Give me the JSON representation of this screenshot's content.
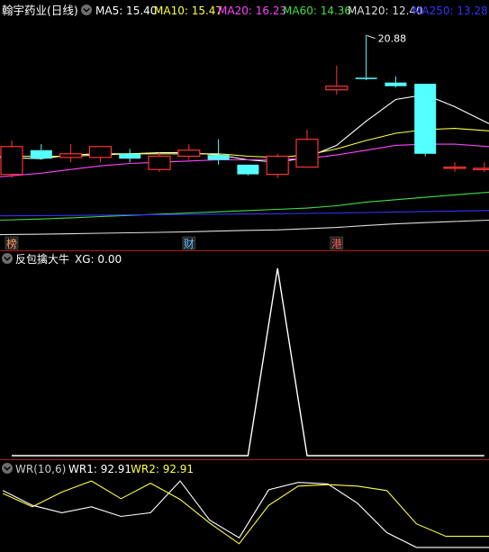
{
  "header": {
    "title": "翰宇药业(日线)",
    "ma_labels": [
      {
        "text": "MA5: 15.40",
        "color": "#ffffff"
      },
      {
        "text": "MA10: 15.47",
        "color": "#ffff44"
      },
      {
        "text": "MA20: 16.23",
        "color": "#ff44ff"
      },
      {
        "text": "MA60: 14.36",
        "color": "#44dd44"
      },
      {
        "text": "MA120: 12.40",
        "color": "#dddddd"
      },
      {
        "text": "MA250: 13.28",
        "color": "#3333ff"
      }
    ]
  },
  "colors": {
    "up": "#ff3333",
    "down": "#54ffff",
    "separator": "#b01818",
    "ma5": "#ffffff",
    "ma10": "#ffff44",
    "ma20": "#ff44ff",
    "ma60": "#44dd44",
    "ma120": "#dddddd",
    "ma250": "#3333ff",
    "xg": "#ffffff",
    "wr1": "#ffffff",
    "wr2": "#ffff44"
  },
  "markers": [
    {
      "text": "榜",
      "bar": 0,
      "color": "#ff9966"
    },
    {
      "text": "财",
      "bar": 6,
      "color": "#66bbff"
    },
    {
      "text": "港",
      "bar": 11,
      "color": "#ff5555"
    }
  ],
  "indicator": {
    "name": "反包擒大牛",
    "value_label": "XG: 0.00"
  },
  "wr_panel": {
    "name": "WR(10,6)",
    "wr1_label": "WR1: 92.91",
    "wr2_label": "WR2: 92.91"
  },
  "chart_data": [
    {
      "type": "candlestick",
      "title": "翰宇药业(日线)",
      "price_range": [
        12.4,
        21.2
      ],
      "candles": [
        {
          "open": 15.1,
          "high": 16.5,
          "low": 14.95,
          "close": 16.25
        },
        {
          "open": 16.1,
          "high": 16.35,
          "low": 15.7,
          "close": 15.75
        },
        {
          "open": 15.8,
          "high": 16.35,
          "low": 15.6,
          "close": 15.95
        },
        {
          "open": 15.8,
          "high": 16.25,
          "low": 15.6,
          "close": 16.25
        },
        {
          "open": 15.95,
          "high": 16.15,
          "low": 15.6,
          "close": 15.75
        },
        {
          "open": 15.3,
          "high": 16.0,
          "low": 15.2,
          "close": 15.85
        },
        {
          "open": 15.85,
          "high": 16.35,
          "low": 15.7,
          "close": 16.1
        },
        {
          "open": 15.9,
          "high": 16.55,
          "low": 15.5,
          "close": 15.7
        },
        {
          "open": 15.5,
          "high": 15.5,
          "low": 15.05,
          "close": 15.1
        },
        {
          "open": 15.1,
          "high": 15.95,
          "low": 14.95,
          "close": 15.85
        },
        {
          "open": 15.4,
          "high": 16.95,
          "low": 15.4,
          "close": 16.55
        },
        {
          "open": 18.6,
          "high": 19.6,
          "low": 18.4,
          "close": 18.75
        },
        {
          "open": 19.1,
          "high": 20.88,
          "low": 19.0,
          "close": 19.05
        },
        {
          "open": 18.9,
          "high": 19.15,
          "low": 18.7,
          "close": 18.75
        },
        {
          "open": 18.85,
          "high": 18.85,
          "low": 15.85,
          "close": 15.95
        },
        {
          "open": 15.4,
          "high": 15.6,
          "low": 15.2,
          "close": 15.4
        },
        {
          "open": 15.3,
          "high": 15.6,
          "low": 15.2,
          "close": 15.35
        }
      ],
      "annotations": [
        {
          "text": "20.88",
          "bar": 12,
          "price": 20.88
        }
      ],
      "series": [
        {
          "name": "MA5",
          "values": [
            15.8,
            15.75,
            15.9,
            15.95,
            15.95,
            16.0,
            16.0,
            15.9,
            15.7,
            15.6,
            15.8,
            16.3,
            17.3,
            18.2,
            18.4,
            17.9,
            17.2
          ]
        },
        {
          "name": "MA10",
          "values": [
            15.85,
            15.85,
            15.85,
            15.9,
            15.95,
            15.95,
            15.95,
            15.95,
            15.85,
            15.8,
            15.9,
            16.15,
            16.5,
            16.8,
            16.95,
            17.0,
            16.9
          ]
        },
        {
          "name": "MA20",
          "values": [
            15.0,
            15.15,
            15.3,
            15.45,
            15.55,
            15.6,
            15.65,
            15.7,
            15.7,
            15.72,
            15.75,
            15.9,
            16.1,
            16.3,
            16.35,
            16.35,
            16.25
          ]
        },
        {
          "name": "MA60",
          "values": [
            13.2,
            13.25,
            13.3,
            13.35,
            13.4,
            13.45,
            13.5,
            13.55,
            13.6,
            13.65,
            13.7,
            13.8,
            13.95,
            14.05,
            14.15,
            14.25,
            14.36
          ]
        },
        {
          "name": "MA120",
          "values": [
            12.6,
            12.62,
            12.64,
            12.66,
            12.68,
            12.7,
            12.72,
            12.75,
            12.78,
            12.8,
            12.85,
            12.9,
            12.98,
            13.05,
            13.1,
            13.15,
            13.2
          ]
        },
        {
          "name": "MA250",
          "values": [
            13.38,
            13.39,
            13.4,
            13.41,
            13.42,
            13.43,
            13.44,
            13.45,
            13.46,
            13.47,
            13.48,
            13.5,
            13.52,
            13.54,
            13.56,
            13.58,
            13.6
          ]
        }
      ]
    },
    {
      "type": "line",
      "title": "反包擒大牛",
      "ylim": [
        0,
        1
      ],
      "series": [
        {
          "name": "XG",
          "values": [
            0,
            0,
            0,
            0,
            0,
            0,
            0,
            0,
            0,
            1,
            0,
            0,
            0,
            0,
            0,
            0,
            0
          ]
        }
      ]
    },
    {
      "type": "line",
      "title": "WR(10,6)",
      "ylim": [
        0,
        100
      ],
      "x_offset_bars": -0.3,
      "series": [
        {
          "name": "WR1",
          "values": [
            18,
            38,
            48,
            40,
            53,
            48,
            5,
            58,
            82,
            17,
            7,
            9,
            35,
            75,
            95,
            95,
            95
          ]
        },
        {
          "name": "WR2",
          "values": [
            22,
            40,
            20,
            5,
            29,
            8,
            30,
            62,
            90,
            38,
            12,
            10,
            12,
            18,
            63,
            80,
            80
          ]
        }
      ]
    }
  ]
}
